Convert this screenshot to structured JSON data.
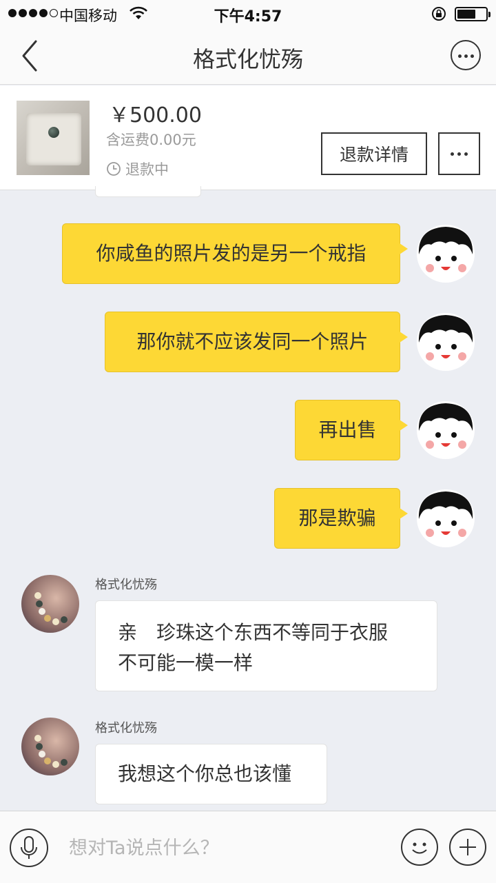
{
  "status_bar": {
    "carrier": "中国移动",
    "time": "下午4:57",
    "signal_icon": "signal-dots-icon",
    "wifi_icon": "wifi-icon",
    "lock_icon": "orientation-lock-icon",
    "battery_level": 0.6
  },
  "header": {
    "title": "格式化忧殇",
    "back_icon": "back-chevron-icon",
    "more_icon": "more-circle-icon"
  },
  "product": {
    "price": "￥500.00",
    "shipping": "含运费0.00元",
    "status": "退款中",
    "status_icon": "clock-icon",
    "refund_button": "退款详情",
    "more_icon": "more-dots-icon"
  },
  "messages": [
    {
      "from": "me",
      "text": "你咸鱼的照片发的是另一个戒指"
    },
    {
      "from": "me",
      "text": "那你就不应该发同一个照片"
    },
    {
      "from": "me",
      "text": "再出售"
    },
    {
      "from": "me",
      "text": "那是欺骗"
    },
    {
      "from": "them",
      "sender": "格式化忧殇",
      "lines": [
        "亲　珍珠这个东西不等同于衣服",
        "不可能一模一样"
      ]
    },
    {
      "from": "them",
      "sender": "格式化忧殇",
      "lines": [
        "我想这个你总也该懂"
      ]
    }
  ],
  "input_bar": {
    "placeholder": "想对Ta说点什么？",
    "voice_icon": "microphone-icon",
    "emoji_icon": "emoji-icon",
    "add_icon": "plus-icon"
  },
  "colors": {
    "my_bubble": "#fdd835",
    "their_bubble": "#ffffff",
    "chat_background": "#eceef3"
  }
}
